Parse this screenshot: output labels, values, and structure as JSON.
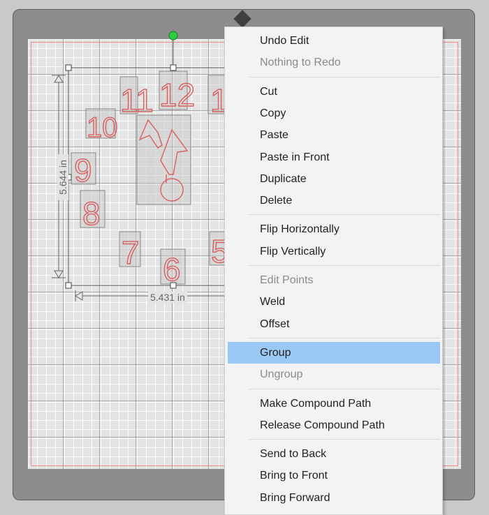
{
  "canvas": {
    "width_label": "5.431 in",
    "height_label": "5.644 in",
    "numbers": [
      "12",
      "11",
      "1",
      "10",
      "9",
      "8",
      "7",
      "6",
      "5"
    ]
  },
  "context_menu": {
    "groups": [
      [
        {
          "label": "Undo Edit",
          "enabled": true
        },
        {
          "label": "Nothing to Redo",
          "enabled": false
        }
      ],
      [
        {
          "label": "Cut",
          "enabled": true
        },
        {
          "label": "Copy",
          "enabled": true
        },
        {
          "label": "Paste",
          "enabled": true
        },
        {
          "label": "Paste in Front",
          "enabled": true
        },
        {
          "label": "Duplicate",
          "enabled": true
        },
        {
          "label": "Delete",
          "enabled": true
        }
      ],
      [
        {
          "label": "Flip Horizontally",
          "enabled": true
        },
        {
          "label": "Flip Vertically",
          "enabled": true
        }
      ],
      [
        {
          "label": "Edit Points",
          "enabled": false
        },
        {
          "label": "Weld",
          "enabled": true
        },
        {
          "label": "Offset",
          "enabled": true
        }
      ],
      [
        {
          "label": "Group",
          "enabled": true,
          "highlighted": true
        },
        {
          "label": "Ungroup",
          "enabled": false
        }
      ],
      [
        {
          "label": "Make Compound Path",
          "enabled": true
        },
        {
          "label": "Release Compound Path",
          "enabled": true
        }
      ],
      [
        {
          "label": "Send to Back",
          "enabled": true
        },
        {
          "label": "Bring to Front",
          "enabled": true
        },
        {
          "label": "Bring Forward",
          "enabled": true
        }
      ]
    ]
  },
  "colors": {
    "highlight": "#9ac9f5",
    "cut_line": "#e06b6b",
    "rotate_handle": "#2ecc40"
  }
}
